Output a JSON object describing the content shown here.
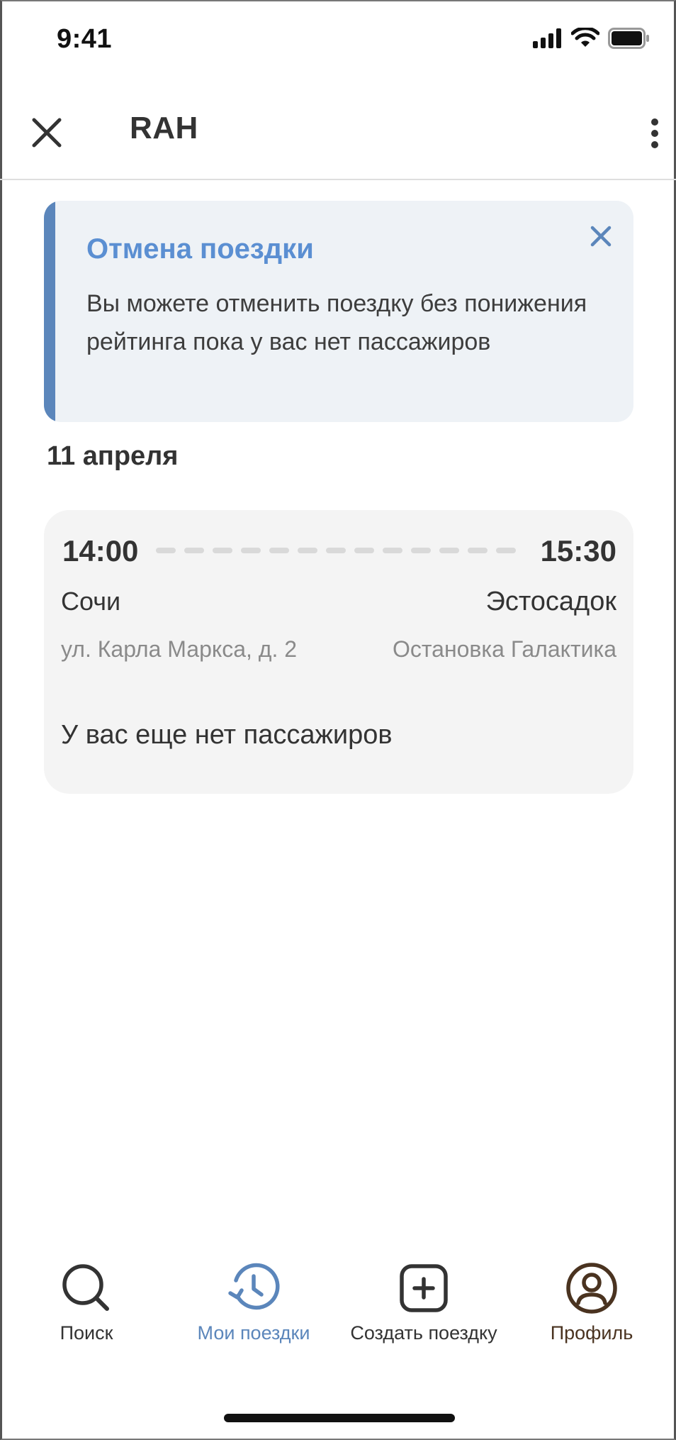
{
  "status_bar": {
    "time": "9:41"
  },
  "header": {
    "title": "RAH"
  },
  "banner": {
    "title": "Отмена поездки",
    "text": "Вы можете отменить поездку без понижения рейтинга  пока у вас нет пассажиров",
    "accent_color": "#5b86bb",
    "title_color": "#5b8fd2"
  },
  "date_heading": "11 апреля",
  "trip": {
    "departure_time": "14:00",
    "arrival_time": "15:30",
    "from_city": "Сочи",
    "to_city": "Эстосадок",
    "from_address": "ул. Карла Маркса, д. 2",
    "to_address": "Остановка Галактика",
    "passengers_status": "У вас еще нет пассажиров"
  },
  "bottom_nav": {
    "items": [
      {
        "label": "Поиск",
        "icon": "search-icon",
        "active": false
      },
      {
        "label": "Мои поездки",
        "icon": "history-icon",
        "active": true
      },
      {
        "label": "Создать поездку",
        "icon": "plus-square-icon",
        "active": false
      },
      {
        "label": "Профиль",
        "icon": "profile-icon",
        "active": false
      }
    ],
    "active_color": "#5b86bb",
    "default_color": "#333333",
    "profile_color": "#4a3320"
  }
}
